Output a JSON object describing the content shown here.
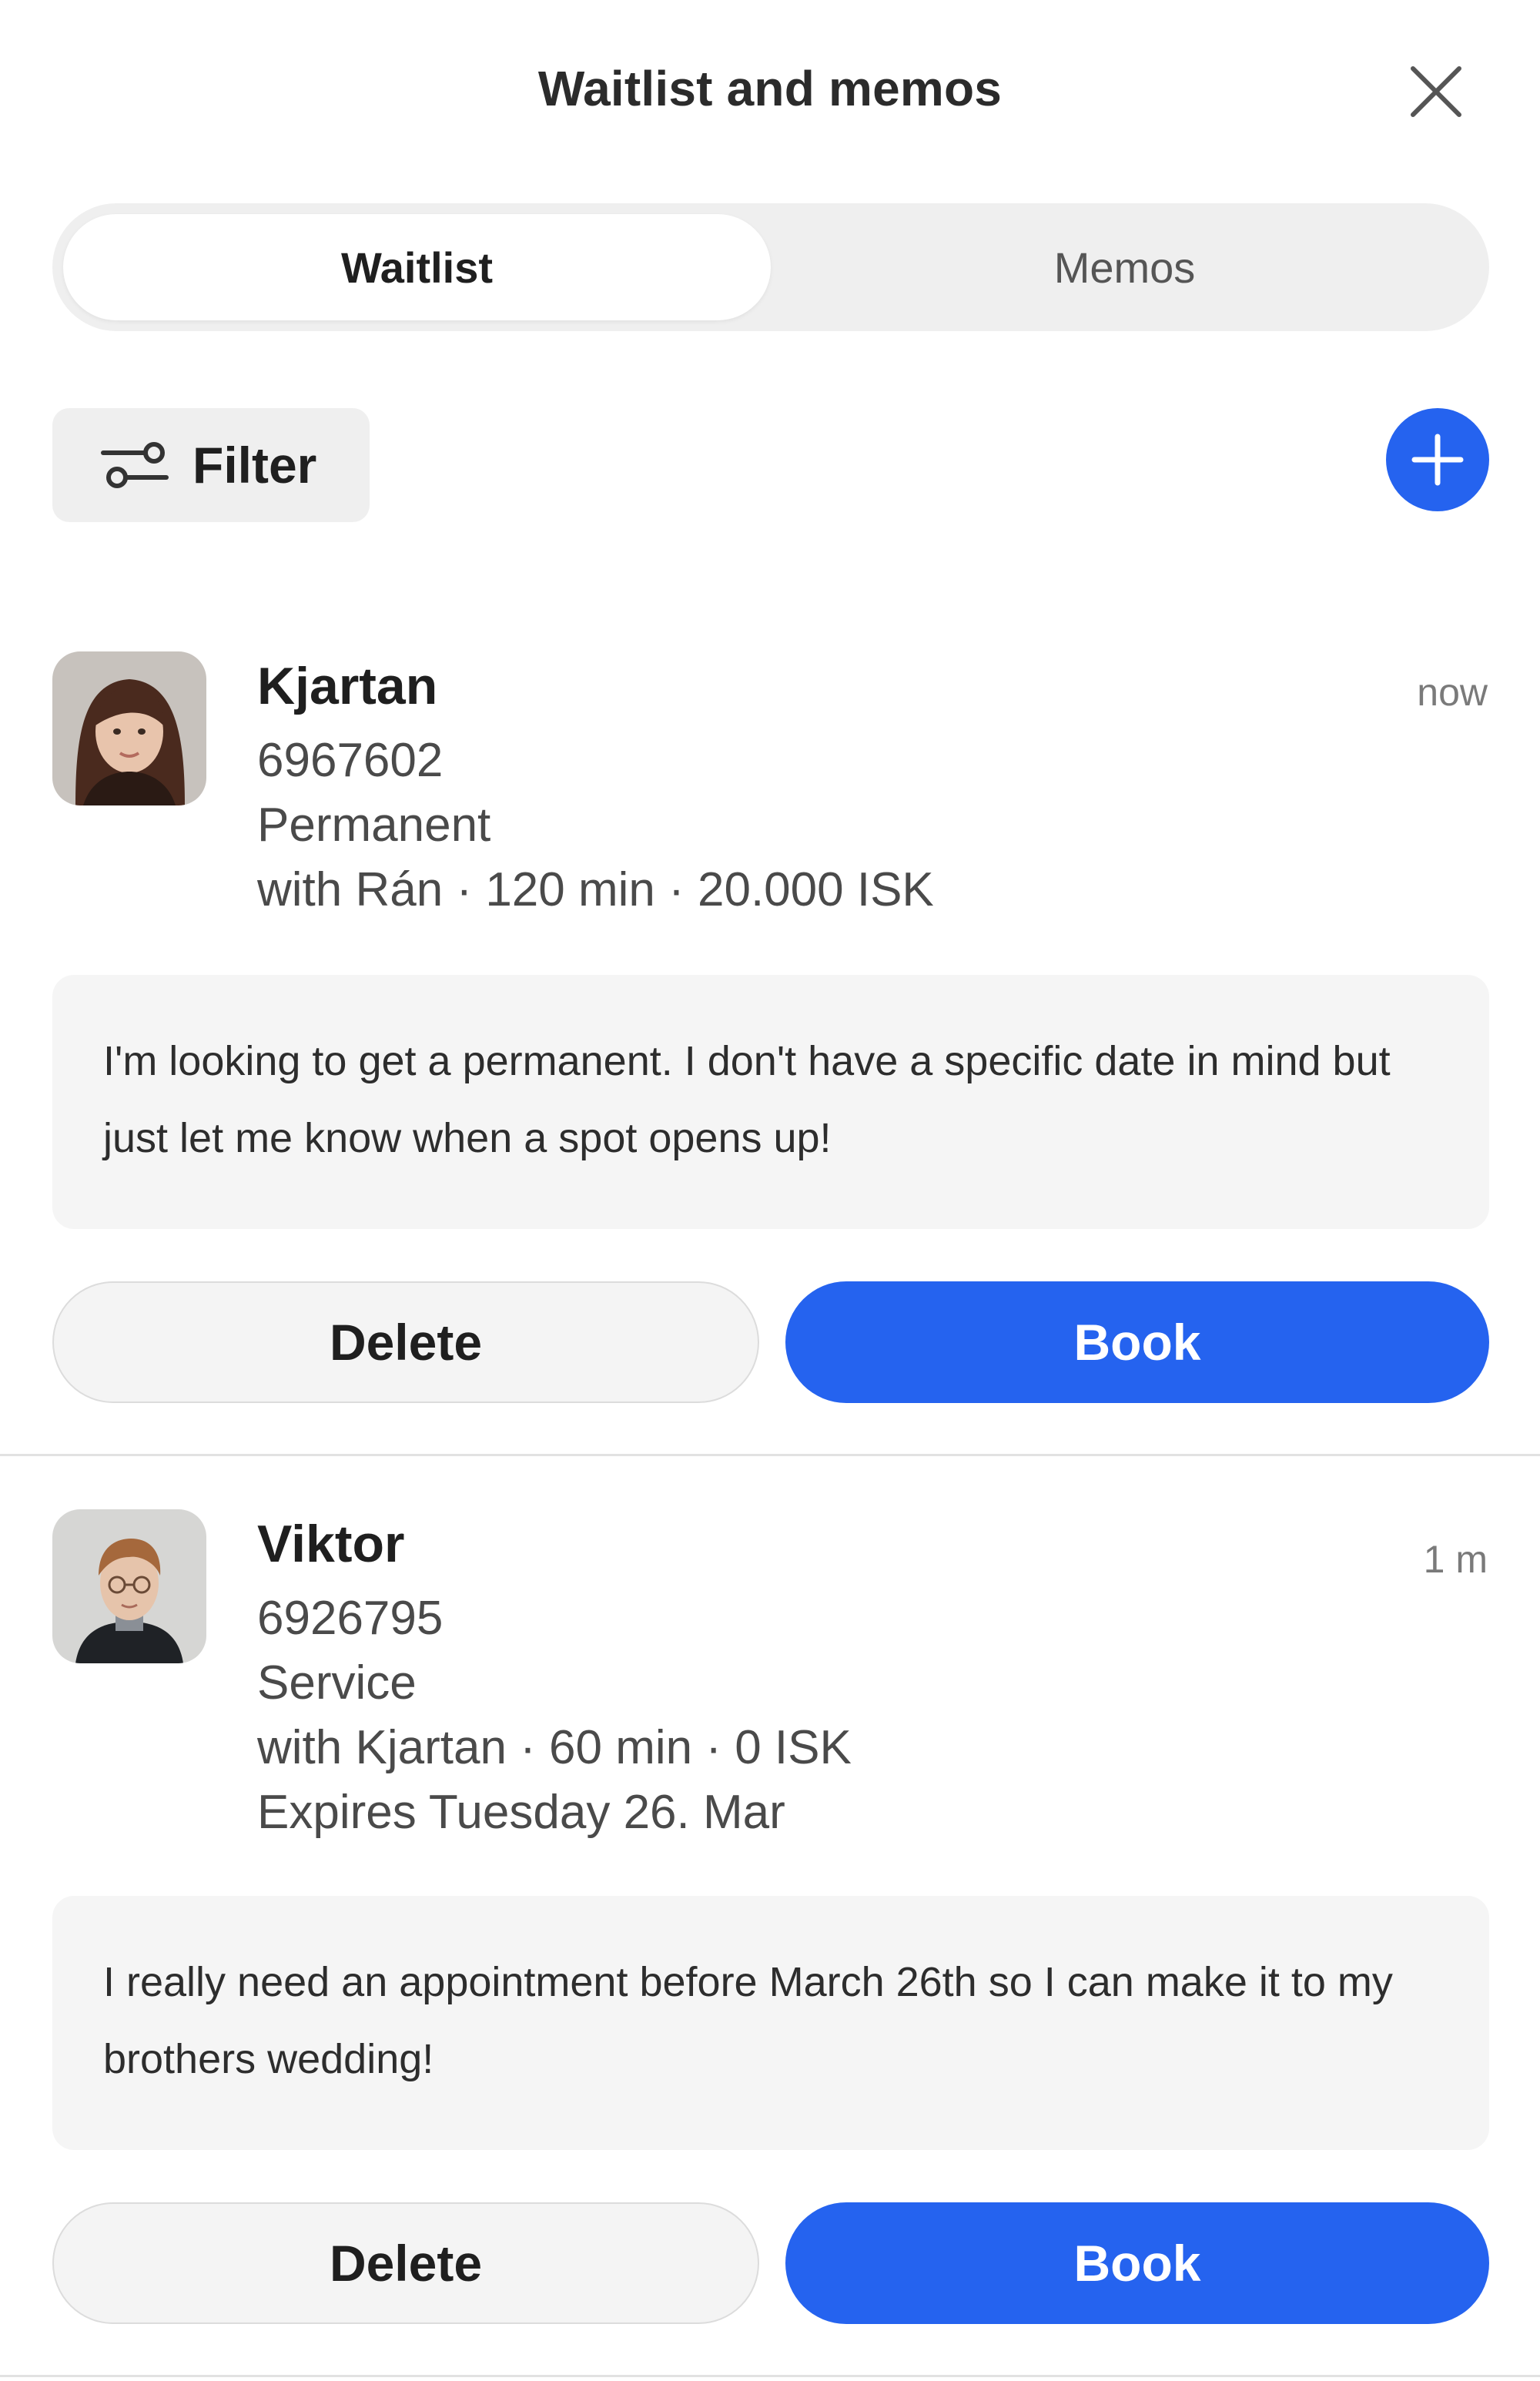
{
  "header": {
    "title": "Waitlist and memos"
  },
  "tabs": [
    {
      "label": "Waitlist",
      "active": true
    },
    {
      "label": "Memos",
      "active": false
    }
  ],
  "toolbar": {
    "filter_label": "Filter"
  },
  "colors": {
    "accent": "#2563ef",
    "surface": "#efefef",
    "note_bg": "#f5f5f5"
  },
  "entries": [
    {
      "name": "Kjartan",
      "time": "now",
      "phone": "6967602",
      "service": "Permanent",
      "details": "with Rán · 120 min · 20.000 ISK",
      "note": "I'm looking to get a permanent. I don't have a specific date in mind but just let me know when a spot opens up!",
      "delete_label": "Delete",
      "book_label": "Book"
    },
    {
      "name": "Viktor",
      "time": "1 m",
      "phone": "6926795",
      "service": "Service",
      "details": "with Kjartan · 60 min · 0 ISK",
      "expires": "Expires Tuesday 26. Mar",
      "note": "I really need an appointment before March 26th so I can make it to my brothers wedding!",
      "delete_label": "Delete",
      "book_label": "Book"
    }
  ]
}
